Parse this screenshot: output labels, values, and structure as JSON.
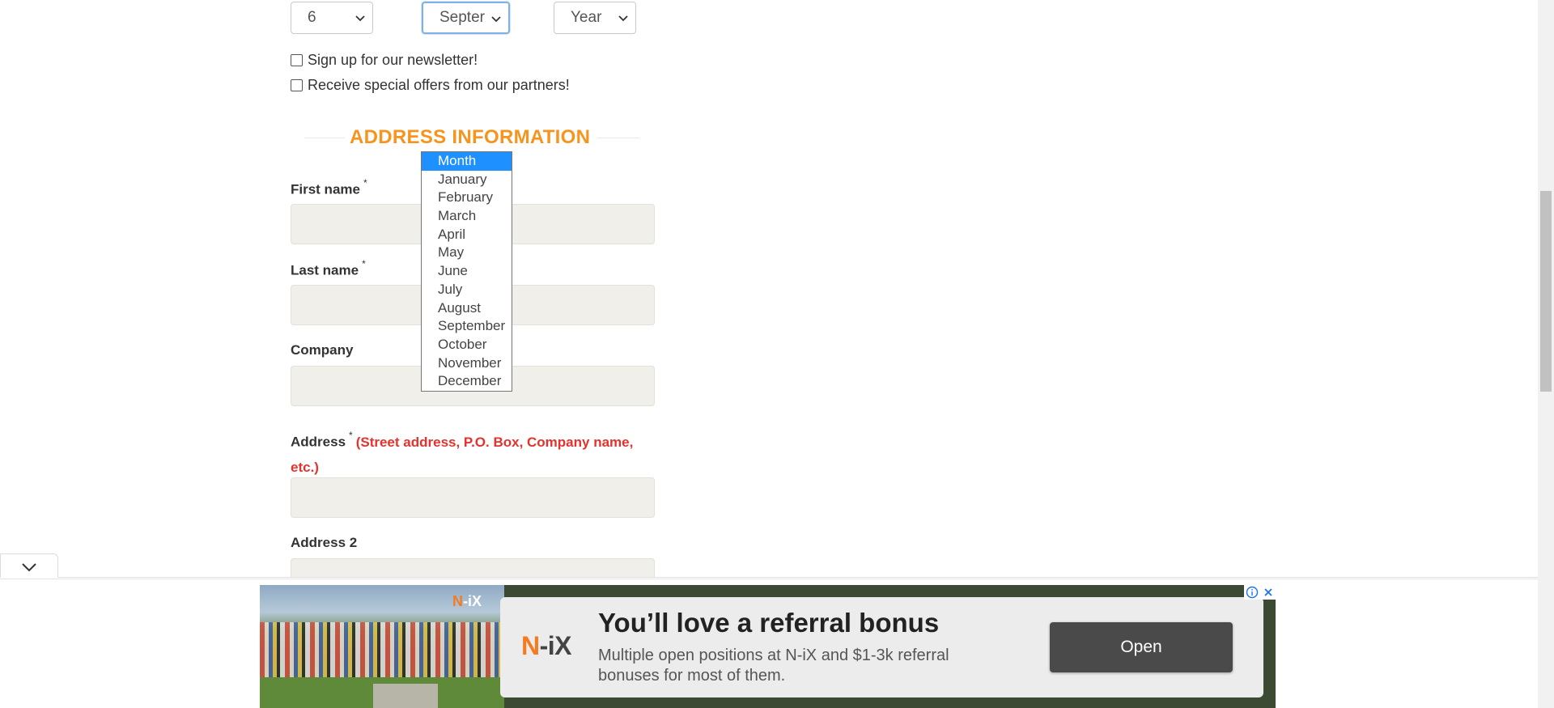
{
  "birthdate": {
    "day_value": "6",
    "month_value": "Septer",
    "year_value": "Year"
  },
  "checkboxes": {
    "newsletter_label": "Sign up for our newsletter!",
    "offers_label": "Receive special offers from our partners!"
  },
  "address_section": {
    "title": "ADDRESS INFORMATION",
    "first_name_label": "First name",
    "last_name_label": "Last name",
    "company_label": "Company",
    "address_label": "Address",
    "address_hint": "(Street address, P.O. Box, Company name, etc.)",
    "address2_label": "Address 2",
    "required_mark": "*"
  },
  "month_dropdown": {
    "options": [
      "Month",
      "January",
      "February",
      "March",
      "April",
      "May",
      "June",
      "July",
      "August",
      "September",
      "October",
      "November",
      "December"
    ],
    "highlighted": "Month"
  },
  "ad": {
    "photo_logo_n": "N",
    "photo_logo_rest": "-iX",
    "logo_n": "N",
    "logo_rest": "-iX",
    "headline": "You’ll love a referral bonus",
    "description": "Multiple open positions at N-iX and $1-3k referral bonuses for most of them.",
    "cta": "Open",
    "accent_color": "#f47b20"
  },
  "colors": {
    "heading_orange": "#f7941d",
    "hint_red": "#e5322d",
    "selected_option_blue": "#1e90ff"
  }
}
